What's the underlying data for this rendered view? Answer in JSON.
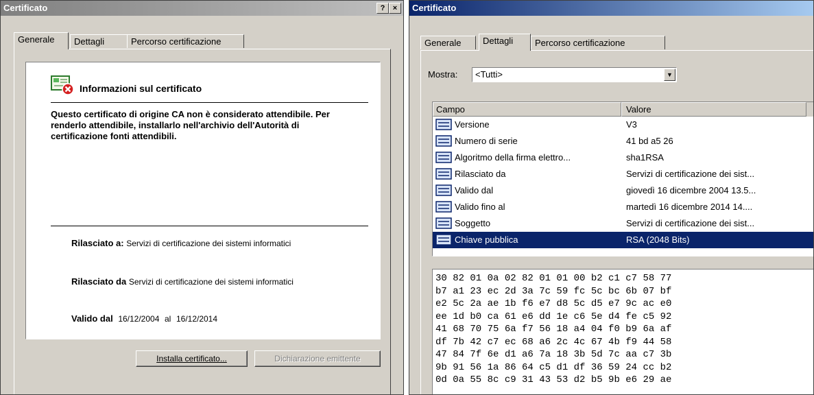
{
  "left_window": {
    "title": "Certificato",
    "help_button": "?",
    "close_button": "×",
    "tabs": [
      "Generale",
      "Dettagli",
      "Percorso certificazione"
    ],
    "info_heading": "Informazioni sul certificato",
    "warning_text": "Questo certificato di origine CA non è considerato attendibile. Per renderlo attendibile, installarlo nell'archivio dell'Autorità di certificazione fonti attendibili.",
    "issued_to_label": "Rilasciato a:",
    "issued_to_value": "Servizi di certificazione dei sistemi informatici",
    "issued_by_label": "Rilasciato da",
    "issued_by_value": "Servizi di certificazione dei sistemi informatici",
    "valid_label": "Valido dal",
    "valid_from": "16/12/2004",
    "valid_to_word": "al",
    "valid_to": "16/12/2014",
    "install_button": "Installa certificato...",
    "issuer_statement_button": "Dichiarazione emittente"
  },
  "right_window": {
    "title": "Certificato",
    "tabs": [
      "Generale",
      "Dettagli",
      "Percorso certificazione"
    ],
    "show_label": "Mostra:",
    "show_value": "<Tutti>",
    "columns": [
      "Campo",
      "Valore"
    ],
    "rows": [
      {
        "field": "Versione",
        "value": "V3"
      },
      {
        "field": "Numero di serie",
        "value": "41 bd a5 26"
      },
      {
        "field": "Algoritmo della firma elettro...",
        "value": "sha1RSA"
      },
      {
        "field": "Rilasciato da",
        "value": "Servizi di certificazione dei sist..."
      },
      {
        "field": "Valido dal",
        "value": "giovedì 16 dicembre 2004 13.5..."
      },
      {
        "field": "Valido fino al",
        "value": "martedì 16 dicembre 2014 14...."
      },
      {
        "field": "Soggetto",
        "value": "Servizi di certificazione dei sist..."
      },
      {
        "field": "Chiave pubblica",
        "value": "RSA (2048 Bits)"
      }
    ],
    "selected_row": 7,
    "hex_lines": [
      "30 82 01 0a 02 82 01 01 00 b2 c1 c7 58 77",
      "b7 a1 23 ec 2d 3a 7c 59 fc 5c bc 6b 07 bf",
      "e2 5c 2a ae 1b f6 e7 d8 5c d5 e7 9c ac e0",
      "ee 1d b0 ca 61 e6 dd 1e c6 5e d4 fe c5 92",
      "41 68 70 75 6a f7 56 18 a4 04 f0 b9 6a af",
      "df 7b 42 c7 ec 68 a6 2c 4c 67 4b f9 44 58",
      "47 84 7f 6e d1 a6 7a 18 3b 5d 7c aa c7 3b",
      "9b 91 56 1a 86 64 c5 d1 df 36 59 24 cc b2",
      "0d 0a 55 8c c9 31 43 53 d2 b5 9b e6 29 ae"
    ]
  }
}
